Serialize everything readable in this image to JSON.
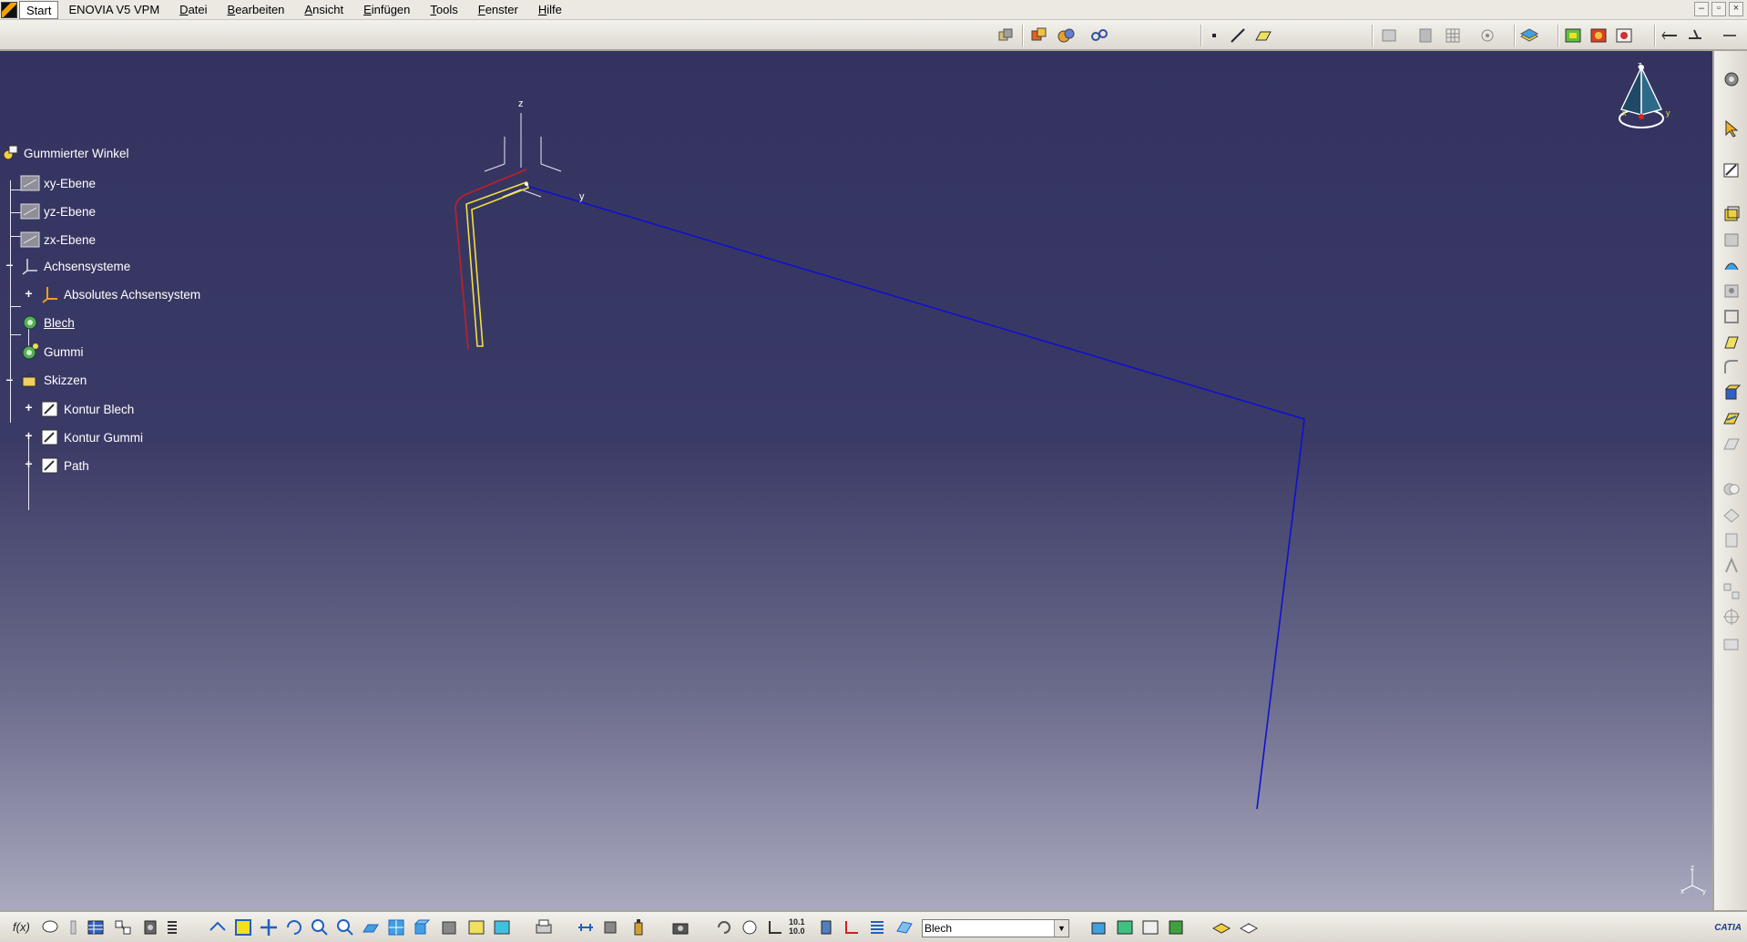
{
  "menubar": {
    "items": [
      "Start",
      "ENOVIA V5 VPM",
      "Datei",
      "Bearbeiten",
      "Ansicht",
      "Einfügen",
      "Tools",
      "Fenster",
      "Hilfe"
    ]
  },
  "window_controls": {
    "minimize": "–",
    "restore": "▫",
    "close": "×"
  },
  "spec_tree": {
    "root": "Gummierter Winkel",
    "nodes": [
      {
        "label": "xy-Ebene",
        "icon": "plane-icon"
      },
      {
        "label": "yz-Ebene",
        "icon": "plane-icon"
      },
      {
        "label": "zx-Ebene",
        "icon": "plane-icon"
      },
      {
        "label": "Achsensysteme",
        "icon": "axis-system-icon"
      },
      {
        "label": "Absolutes Achsensystem",
        "icon": "axis-system-icon"
      },
      {
        "label": "Blech",
        "icon": "part-icon"
      },
      {
        "label": "Gummi",
        "icon": "part-icon"
      },
      {
        "label": "Skizzen",
        "icon": "geometrical-set-icon"
      },
      {
        "label": "Kontur Blech",
        "icon": "sketch-icon"
      },
      {
        "label": "Kontur Gummi",
        "icon": "sketch-icon"
      },
      {
        "label": "Path",
        "icon": "sketch-icon"
      }
    ]
  },
  "axis_labels": {
    "z": "z",
    "y": "y"
  },
  "compass_labels": {
    "z": "z",
    "x": "x",
    "y": "y"
  },
  "mini_axis_labels": {
    "z": "z",
    "x": "x",
    "y": "y"
  },
  "bottom_toolbar": {
    "current_part": "Blech",
    "formula_label": "f(x)",
    "brand": "CATIA"
  },
  "colors": {
    "viewport_top": "#34335f",
    "viewport_bottom": "#a9a9bf",
    "path_line": "#1010d0",
    "gummi_contour": "#c0202a",
    "blech_contour": "#f0e040",
    "tree_text": "#ffffff"
  }
}
